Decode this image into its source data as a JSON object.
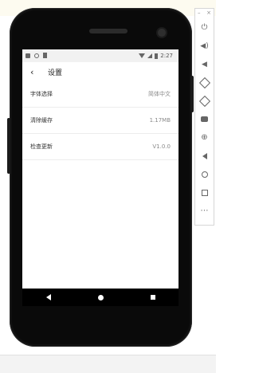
{
  "status_bar": {
    "time": "2:27"
  },
  "app_bar": {
    "title": "设置",
    "back_glyph": "‹"
  },
  "settings_items": [
    {
      "label": "字体选择",
      "value": "简体中文"
    },
    {
      "label": "清除缓存",
      "value": "1.17MB"
    },
    {
      "label": "检查更新",
      "value": "V1.0.0"
    }
  ],
  "emulator_toolbar": {
    "minimize": "–",
    "close": "×",
    "buttons": [
      "power-icon",
      "volume-up-icon",
      "volume-down-icon",
      "rotate-left-icon",
      "rotate-right-icon",
      "camera-icon",
      "zoom-icon",
      "back-icon",
      "home-icon",
      "overview-icon",
      "more-icon"
    ],
    "power_glyph": "⏻",
    "vol_up_glyph": "🔊",
    "vol_down_glyph": "🔉",
    "zoom_glyph": "⊕",
    "more_glyph": "⋯"
  }
}
